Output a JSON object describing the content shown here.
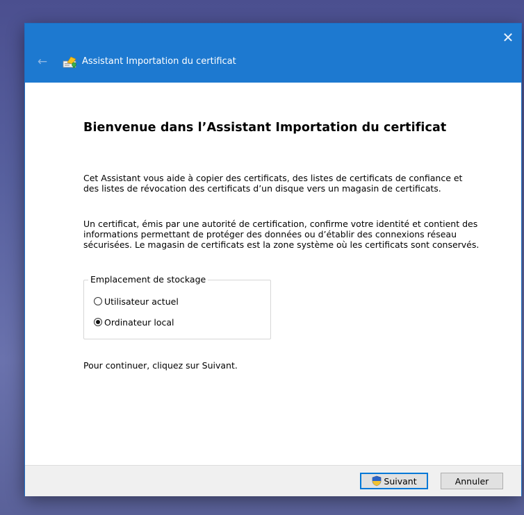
{
  "window": {
    "title": "Assistant Importation du certificat",
    "close_glyph": "✕",
    "back_glyph": "←",
    "app_icon": "certificate-icon"
  },
  "main": {
    "heading": "Bienvenue dans l’Assistant Importation du certificat",
    "paragraph1": "Cet Assistant vous aide à copier des certificats, des listes de certificats de confiance et des listes de révocation des certificats d’un disque vers un magasin de certificats.",
    "paragraph2": "Un certificat, émis par une autorité de certification, confirme votre identité et contient des informations permettant de protéger des données ou d’établir des connexions réseau sécurisées. Le magasin de certificats est la zone système où les certificats sont conservés.",
    "storage_group": {
      "legend": "Emplacement de stockage",
      "options": [
        {
          "label": "Utilisateur actuel",
          "selected": false
        },
        {
          "label": "Ordinateur local",
          "selected": true
        }
      ]
    },
    "continue_text": "Pour continuer, cliquez sur Suivant."
  },
  "buttons": {
    "next_label": "Suivant",
    "next_icon": "uac-shield-icon",
    "cancel_label": "Annuler"
  },
  "colors": {
    "titlebar": "#1d79d0",
    "accent": "#0078d7",
    "footer_bg": "#f0f0f0"
  }
}
